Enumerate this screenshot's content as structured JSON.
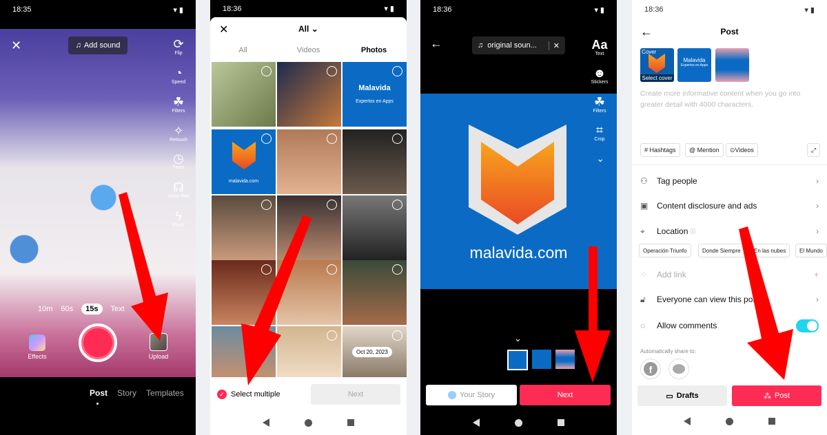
{
  "camera": {
    "time": "18:35",
    "add_sound": "Add sound",
    "tools": [
      {
        "icon": "flip-icon",
        "label": "Flip"
      },
      {
        "icon": "speed-icon",
        "label": "Speed"
      },
      {
        "icon": "filters-icon",
        "label": "Filters"
      },
      {
        "icon": "retouch-icon",
        "label": "Retouch"
      },
      {
        "icon": "timer-icon",
        "label": "Timer"
      },
      {
        "icon": "voice-filter-icon",
        "label": "Voice filter"
      },
      {
        "icon": "flash-icon",
        "label": "Flash"
      }
    ],
    "durations": [
      "10m",
      "60s",
      "15s",
      "Text"
    ],
    "selected_duration": "15s",
    "effects": "Effects",
    "upload": "Upload",
    "modes": [
      "Post",
      "Story",
      "Templates"
    ],
    "selected_mode": "Post"
  },
  "gallery": {
    "time": "18:36",
    "album": "All",
    "tabs": [
      "All",
      "Videos",
      "Photos"
    ],
    "selected_tab": "Photos",
    "malavida_tile": "Malavida",
    "malavida_sub": "Expertos en Apps",
    "malavida_url": "malavida.com",
    "date_badge": "Oct 20, 2023",
    "select_multiple": "Select multiple",
    "next": "Next"
  },
  "editor": {
    "time": "18:36",
    "sound": "original soun...",
    "tools": [
      {
        "icon": "text-icon",
        "label": "Text",
        "glyph": "Aa"
      },
      {
        "icon": "stickers-icon",
        "label": "Stickers"
      },
      {
        "icon": "filters-icon",
        "label": "Filters"
      },
      {
        "icon": "crop-icon",
        "label": "Crop"
      }
    ],
    "image_text": "malavida.com",
    "your_story": "Your Story",
    "next": "Next"
  },
  "post": {
    "time": "18:36",
    "title": "Post",
    "cover_label": "Cover",
    "select_cover": "Select cover",
    "thumb_title": "Malavida",
    "thumb_sub": "Expertos en Apps",
    "description_placeholder": "Create more informative content when you go into greater detail with 4000 characters.",
    "chips": [
      "# Hashtags",
      "@ Mention",
      "Videos"
    ],
    "rows": {
      "tag_people": "Tag people",
      "disclosure": "Content disclosure and ads",
      "location": "Location",
      "add_link": "Add link",
      "visibility": "Everyone can view this post",
      "comments": "Allow comments"
    },
    "location_suggestions": [
      "Operación Triunfo",
      "Donde Siempre",
      "En las nubes",
      "El Mundo"
    ],
    "allow_comments": true,
    "share_label": "Automatically share to:",
    "drafts": "Drafts",
    "post": "Post"
  },
  "colors": {
    "accent": "#fe2c55",
    "toggle": "#20d5ec",
    "malavida_blue": "#0b6bc4",
    "arrow": "#ff0000"
  }
}
